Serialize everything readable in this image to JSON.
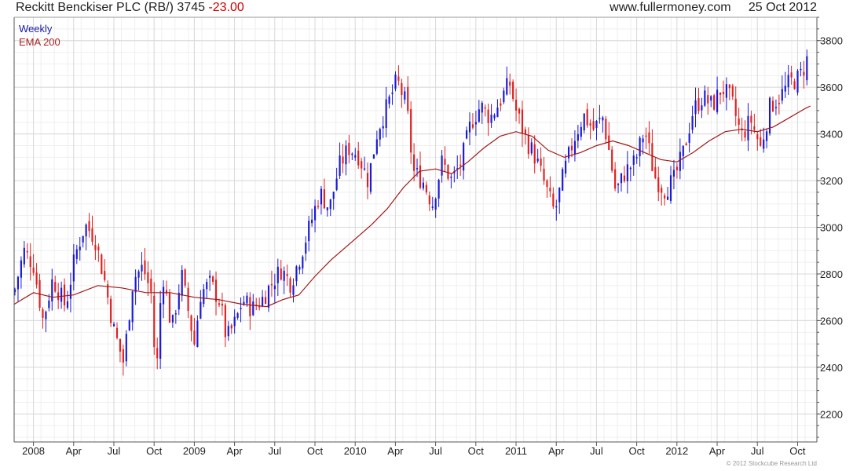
{
  "header": {
    "title": "Reckitt Benckiser PLC (RB/)",
    "last_price": "3745",
    "change": "-23.00",
    "site": "www.fullermoney.com",
    "date": "25 Oct 2012"
  },
  "copyright": "© 2012 Stockcube Research Ltd",
  "colors": {
    "up": "#1a1ad6",
    "down": "#e02020",
    "ema": "#a01818",
    "grid": "#d8d8d8"
  },
  "chart_data": {
    "type": "candlestick",
    "grid": true,
    "legend": {
      "position": "top-left",
      "entries": [
        "Weekly",
        "EMA 200"
      ]
    },
    "ylim": [
      2080,
      3900
    ],
    "xlim": [
      2007.88,
      2012.87
    ],
    "yticks": [
      2200,
      2400,
      2600,
      2800,
      3000,
      3200,
      3400,
      3600,
      3800
    ],
    "xticks": [
      {
        "label": "2008",
        "x": 2008.0
      },
      {
        "label": "Apr",
        "x": 2008.25
      },
      {
        "label": "Jul",
        "x": 2008.5
      },
      {
        "label": "Oct",
        "x": 2008.75
      },
      {
        "label": "2009",
        "x": 2009.0
      },
      {
        "label": "Apr",
        "x": 2009.25
      },
      {
        "label": "Jul",
        "x": 2009.5
      },
      {
        "label": "Oct",
        "x": 2009.75
      },
      {
        "label": "2010",
        "x": 2010.0
      },
      {
        "label": "Apr",
        "x": 2010.25
      },
      {
        "label": "Jul",
        "x": 2010.5
      },
      {
        "label": "Oct",
        "x": 2010.75
      },
      {
        "label": "2011",
        "x": 2011.0
      },
      {
        "label": "Apr",
        "x": 2011.25
      },
      {
        "label": "Jul",
        "x": 2011.5
      },
      {
        "label": "Oct",
        "x": 2011.75
      },
      {
        "label": "2012",
        "x": 2012.0
      },
      {
        "label": "Apr",
        "x": 2012.25
      },
      {
        "label": "Jul",
        "x": 2012.5
      },
      {
        "label": "Oct",
        "x": 2012.75
      }
    ],
    "weekly_close": [
      {
        "x": 2007.88,
        "y": 2720
      },
      {
        "x": 2007.94,
        "y": 2900
      },
      {
        "x": 2008.0,
        "y": 2840
      },
      {
        "x": 2008.06,
        "y": 2600
      },
      {
        "x": 2008.12,
        "y": 2780
      },
      {
        "x": 2008.2,
        "y": 2660
      },
      {
        "x": 2008.26,
        "y": 2880
      },
      {
        "x": 2008.32,
        "y": 3010
      },
      {
        "x": 2008.38,
        "y": 2960
      },
      {
        "x": 2008.44,
        "y": 2780
      },
      {
        "x": 2008.5,
        "y": 2560
      },
      {
        "x": 2008.56,
        "y": 2420
      },
      {
        "x": 2008.62,
        "y": 2780
      },
      {
        "x": 2008.68,
        "y": 2830
      },
      {
        "x": 2008.74,
        "y": 2700
      },
      {
        "x": 2008.76,
        "y": 2300
      },
      {
        "x": 2008.8,
        "y": 2820
      },
      {
        "x": 2008.86,
        "y": 2560
      },
      {
        "x": 2008.92,
        "y": 2800
      },
      {
        "x": 2009.0,
        "y": 2500
      },
      {
        "x": 2009.04,
        "y": 2720
      },
      {
        "x": 2009.1,
        "y": 2760
      },
      {
        "x": 2009.16,
        "y": 2680
      },
      {
        "x": 2009.2,
        "y": 2520
      },
      {
        "x": 2009.26,
        "y": 2600
      },
      {
        "x": 2009.3,
        "y": 2690
      },
      {
        "x": 2009.36,
        "y": 2650
      },
      {
        "x": 2009.42,
        "y": 2690
      },
      {
        "x": 2009.48,
        "y": 2760
      },
      {
        "x": 2009.54,
        "y": 2820
      },
      {
        "x": 2009.6,
        "y": 2760
      },
      {
        "x": 2009.66,
        "y": 2880
      },
      {
        "x": 2009.72,
        "y": 3010
      },
      {
        "x": 2009.78,
        "y": 3150
      },
      {
        "x": 2009.84,
        "y": 3080
      },
      {
        "x": 2009.9,
        "y": 3260
      },
      {
        "x": 2009.96,
        "y": 3340
      },
      {
        "x": 2010.02,
        "y": 3310
      },
      {
        "x": 2010.08,
        "y": 3200
      },
      {
        "x": 2010.14,
        "y": 3420
      },
      {
        "x": 2010.2,
        "y": 3520
      },
      {
        "x": 2010.26,
        "y": 3630
      },
      {
        "x": 2010.32,
        "y": 3520
      },
      {
        "x": 2010.36,
        "y": 3240
      },
      {
        "x": 2010.42,
        "y": 3200
      },
      {
        "x": 2010.48,
        "y": 3100
      },
      {
        "x": 2010.54,
        "y": 3280
      },
      {
        "x": 2010.6,
        "y": 3200
      },
      {
        "x": 2010.66,
        "y": 3280
      },
      {
        "x": 2010.72,
        "y": 3450
      },
      {
        "x": 2010.78,
        "y": 3520
      },
      {
        "x": 2010.84,
        "y": 3470
      },
      {
        "x": 2010.9,
        "y": 3540
      },
      {
        "x": 2010.96,
        "y": 3620
      },
      {
        "x": 2011.0,
        "y": 3500
      },
      {
        "x": 2011.06,
        "y": 3380
      },
      {
        "x": 2011.12,
        "y": 3300
      },
      {
        "x": 2011.18,
        "y": 3180
      },
      {
        "x": 2011.24,
        "y": 3060
      },
      {
        "x": 2011.3,
        "y": 3240
      },
      {
        "x": 2011.36,
        "y": 3380
      },
      {
        "x": 2011.42,
        "y": 3480
      },
      {
        "x": 2011.48,
        "y": 3420
      },
      {
        "x": 2011.54,
        "y": 3470
      },
      {
        "x": 2011.58,
        "y": 3320
      },
      {
        "x": 2011.62,
        "y": 3150
      },
      {
        "x": 2011.68,
        "y": 3240
      },
      {
        "x": 2011.74,
        "y": 3280
      },
      {
        "x": 2011.8,
        "y": 3420
      },
      {
        "x": 2011.86,
        "y": 3220
      },
      {
        "x": 2011.92,
        "y": 3160
      },
      {
        "x": 2011.98,
        "y": 3200
      },
      {
        "x": 2012.04,
        "y": 3320
      },
      {
        "x": 2012.1,
        "y": 3500
      },
      {
        "x": 2012.16,
        "y": 3560
      },
      {
        "x": 2012.22,
        "y": 3520
      },
      {
        "x": 2012.28,
        "y": 3600
      },
      {
        "x": 2012.34,
        "y": 3540
      },
      {
        "x": 2012.4,
        "y": 3390
      },
      {
        "x": 2012.46,
        "y": 3460
      },
      {
        "x": 2012.52,
        "y": 3340
      },
      {
        "x": 2012.58,
        "y": 3520
      },
      {
        "x": 2012.64,
        "y": 3560
      },
      {
        "x": 2012.7,
        "y": 3620
      },
      {
        "x": 2012.76,
        "y": 3640
      },
      {
        "x": 2012.8,
        "y": 3700
      },
      {
        "x": 2012.82,
        "y": 3745
      }
    ],
    "ema_200": [
      {
        "x": 2007.88,
        "y": 2670
      },
      {
        "x": 2008.0,
        "y": 2720
      },
      {
        "x": 2008.12,
        "y": 2700
      },
      {
        "x": 2008.25,
        "y": 2710
      },
      {
        "x": 2008.4,
        "y": 2750
      },
      {
        "x": 2008.55,
        "y": 2740
      },
      {
        "x": 2008.7,
        "y": 2720
      },
      {
        "x": 2008.85,
        "y": 2720
      },
      {
        "x": 2009.0,
        "y": 2700
      },
      {
        "x": 2009.15,
        "y": 2690
      },
      {
        "x": 2009.3,
        "y": 2670
      },
      {
        "x": 2009.45,
        "y": 2660
      },
      {
        "x": 2009.55,
        "y": 2690
      },
      {
        "x": 2009.65,
        "y": 2710
      },
      {
        "x": 2009.75,
        "y": 2790
      },
      {
        "x": 2009.85,
        "y": 2860
      },
      {
        "x": 2010.0,
        "y": 2950
      },
      {
        "x": 2010.1,
        "y": 3010
      },
      {
        "x": 2010.2,
        "y": 3080
      },
      {
        "x": 2010.3,
        "y": 3170
      },
      {
        "x": 2010.4,
        "y": 3240
      },
      {
        "x": 2010.5,
        "y": 3250
      },
      {
        "x": 2010.6,
        "y": 3230
      },
      {
        "x": 2010.7,
        "y": 3280
      },
      {
        "x": 2010.8,
        "y": 3340
      },
      {
        "x": 2010.9,
        "y": 3390
      },
      {
        "x": 2011.0,
        "y": 3410
      },
      {
        "x": 2011.1,
        "y": 3390
      },
      {
        "x": 2011.2,
        "y": 3330
      },
      {
        "x": 2011.3,
        "y": 3300
      },
      {
        "x": 2011.4,
        "y": 3320
      },
      {
        "x": 2011.5,
        "y": 3350
      },
      {
        "x": 2011.6,
        "y": 3370
      },
      {
        "x": 2011.7,
        "y": 3350
      },
      {
        "x": 2011.8,
        "y": 3320
      },
      {
        "x": 2011.9,
        "y": 3290
      },
      {
        "x": 2012.0,
        "y": 3280
      },
      {
        "x": 2012.1,
        "y": 3320
      },
      {
        "x": 2012.2,
        "y": 3370
      },
      {
        "x": 2012.3,
        "y": 3410
      },
      {
        "x": 2012.4,
        "y": 3420
      },
      {
        "x": 2012.5,
        "y": 3410
      },
      {
        "x": 2012.6,
        "y": 3430
      },
      {
        "x": 2012.7,
        "y": 3470
      },
      {
        "x": 2012.8,
        "y": 3510
      },
      {
        "x": 2012.83,
        "y": 3520
      }
    ]
  }
}
